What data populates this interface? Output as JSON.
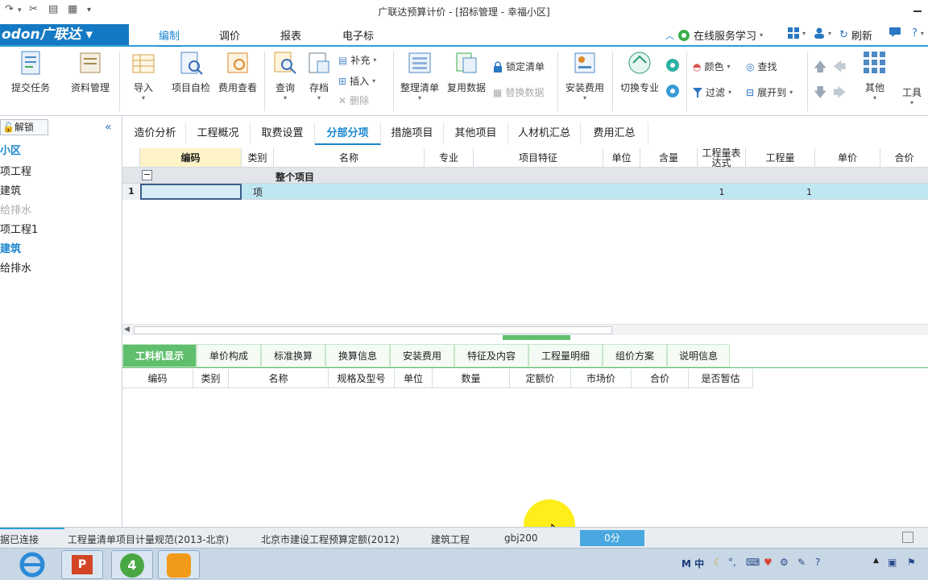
{
  "window": {
    "title": "广联达预算计价 - [招标管理 - 幸福小区]"
  },
  "ribbon_tabs": {
    "logo": "odon广联达",
    "tabs": [
      "编制",
      "调价",
      "报表",
      "电子标"
    ],
    "online_service": "在线服务学习",
    "refresh": "刷新",
    "help": "?"
  },
  "ribbon": {
    "submit_task": "提交任务",
    "data_mgmt": "资料管理",
    "import": "导入",
    "self_check": "项目自检",
    "fee_view": "费用查看",
    "query": "查询",
    "archive": "存档",
    "supplement": "补充",
    "insert": "插入",
    "delete": "删除",
    "organize_list": "整理清单",
    "reuse_data": "复用数据",
    "lock_list": "锁定清单",
    "replace_data": "替换数据",
    "install_fee": "安装费用",
    "switch_major": "切换专业",
    "color": "颜色",
    "find": "查找",
    "filter": "过滤",
    "expand_to": "展开到",
    "other": "其他",
    "tools": "工具"
  },
  "left_panel": {
    "unlock": "解锁",
    "items": [
      "小区",
      "项工程",
      "建筑",
      "给排水",
      "项工程1",
      "建筑",
      "给排水"
    ]
  },
  "doc_tabs": [
    "造价分析",
    "工程概况",
    "取费设置",
    "分部分项",
    "措施项目",
    "其他项目",
    "人材机汇总",
    "费用汇总"
  ],
  "grid": {
    "headers": [
      "编码",
      "类别",
      "名称",
      "专业",
      "项目特征",
      "单位",
      "含量",
      "工程量表达式",
      "工程量",
      "单价",
      "合价"
    ],
    "group_label": "整个项目",
    "row1": {
      "num": "1",
      "type": "项",
      "qty_expr": "1",
      "qty": "1"
    }
  },
  "bottom_tabs": [
    "工料机显示",
    "单价构成",
    "标准换算",
    "换算信息",
    "安装费用",
    "特征及内容",
    "工程量明细",
    "组价方案",
    "说明信息"
  ],
  "bottom_grid": {
    "headers": [
      "编码",
      "类别",
      "名称",
      "规格及型号",
      "单位",
      "数量",
      "定额价",
      "市场价",
      "合价",
      "是否暂估"
    ]
  },
  "status": {
    "conn": "据已连接",
    "spec": "工程量清单项目计量规范(2013-北京)",
    "quota": "北京市建设工程预算定额(2012)",
    "major": "建筑工程",
    "code": "gbj200",
    "score": "0分"
  },
  "taskbar": {
    "ime": "M 中"
  },
  "colors": {
    "accent_blue": "#1a86d0",
    "logo_blue": "#1479c4",
    "green_tab": "#5fbf6d",
    "row_highlight": "#bfe7f2"
  }
}
